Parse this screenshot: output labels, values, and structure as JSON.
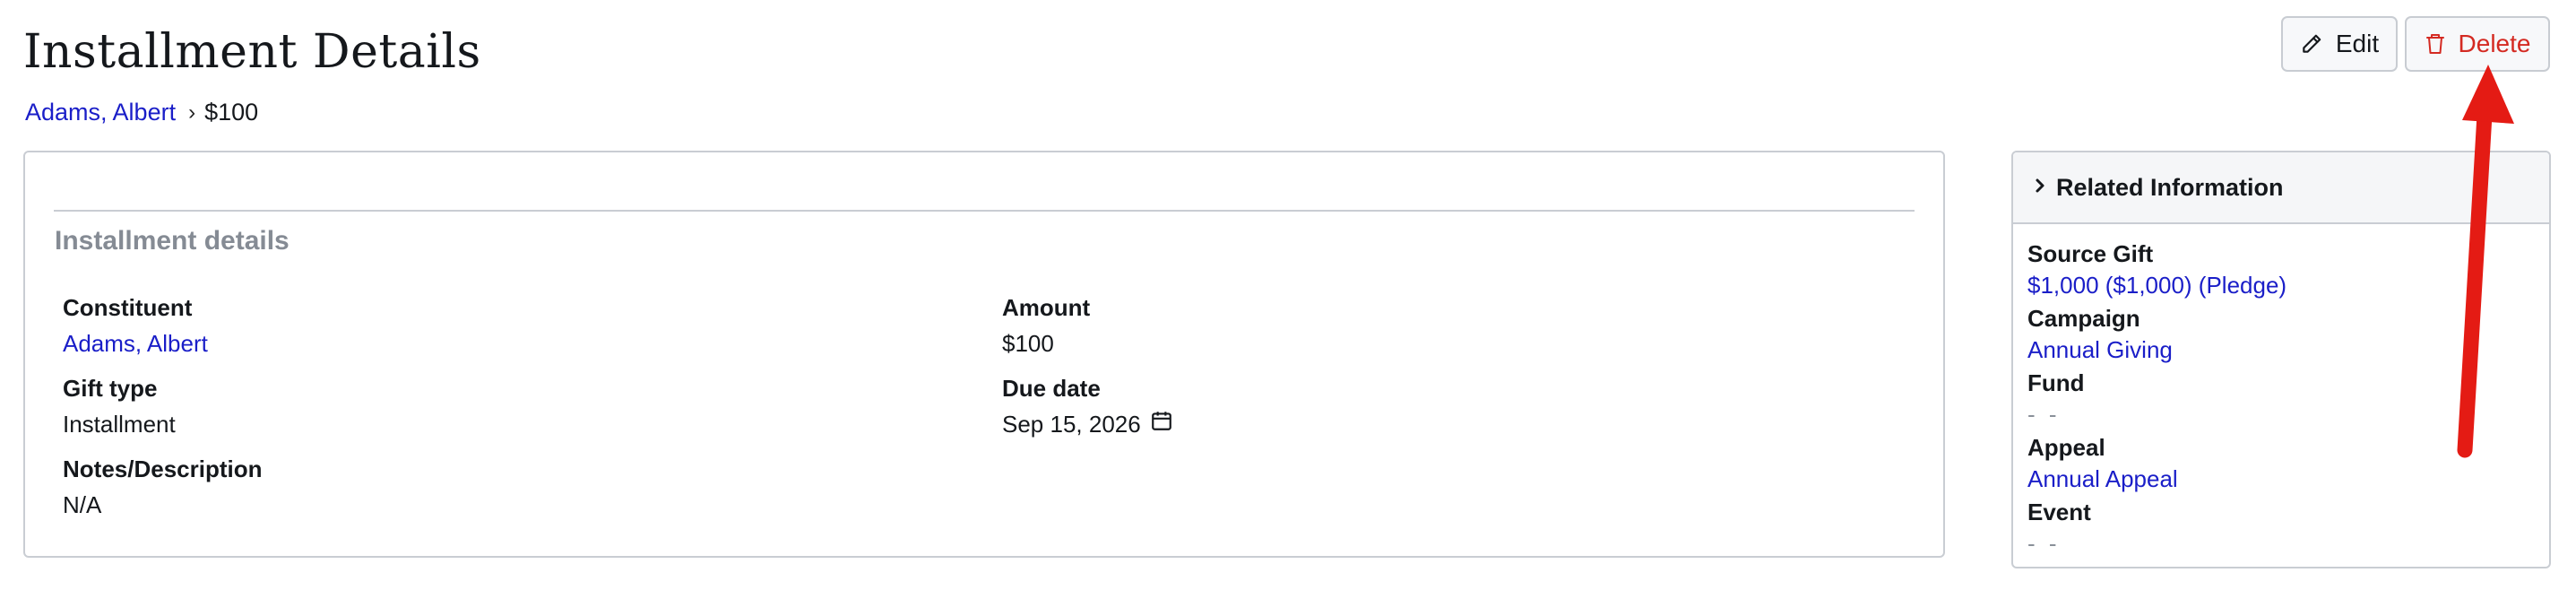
{
  "header": {
    "title": "Installment Details",
    "breadcrumb": {
      "parent": "Adams, Albert",
      "separator": "›",
      "current": "$100"
    }
  },
  "actions": {
    "edit_label": "Edit",
    "delete_label": "Delete"
  },
  "details": {
    "section_title": "Installment details",
    "fields": {
      "constituent": {
        "label": "Constituent",
        "value": "Adams, Albert"
      },
      "amount": {
        "label": "Amount",
        "value": "$100"
      },
      "gift_type": {
        "label": "Gift type",
        "value": "Installment"
      },
      "due_date": {
        "label": "Due date",
        "value": "Sep 15, 2026"
      },
      "notes": {
        "label": "Notes/Description",
        "value": "N/A"
      }
    }
  },
  "related": {
    "title": "Related Information",
    "items": [
      {
        "label": "Source Gift",
        "value": "$1,000 ($1,000) (Pledge)"
      },
      {
        "label": "Campaign",
        "value": "Annual Giving"
      },
      {
        "label": "Fund",
        "value": "- -"
      },
      {
        "label": "Appeal",
        "value": "Annual Appeal"
      },
      {
        "label": "Event",
        "value": "- -"
      }
    ]
  },
  "colors": {
    "link": "#1a1ec8",
    "delete": "#d42a22",
    "annotation_arrow": "#e41b14",
    "muted": "#858b94"
  },
  "icons": [
    "pencil-icon",
    "trash-icon",
    "chevron-right-icon",
    "calendar-icon"
  ]
}
